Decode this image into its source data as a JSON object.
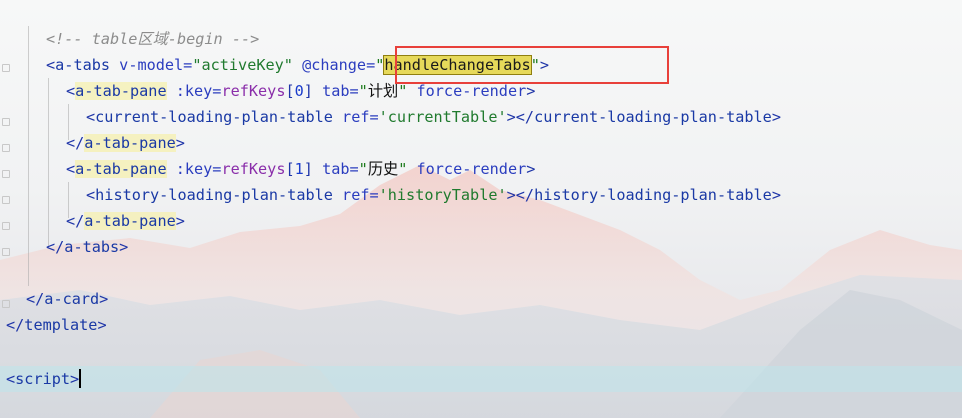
{
  "editor": {
    "lines": {
      "comment": "<!-- table区域-begin -->",
      "tabs_open": {
        "lt": "<",
        "name": "a-tabs",
        "attr1": " v-model=",
        "val1": "\"activeKey\"",
        "attr2": " @change=",
        "q1": "\"",
        "handler": "handleChangeTabs",
        "q2": "\"",
        "gt": ">"
      },
      "pane1_open": {
        "lt": "<",
        "name": "a-tab-pane",
        "attr1": " :key=",
        "expr": "refKeys",
        "idx_open": "[",
        "idx": "0",
        "idx_close": "]",
        "attr2": " tab=",
        "q1": "\"",
        "cjk": "计划",
        "q2": "\"",
        "attr3": " force-render",
        "gt": ">"
      },
      "current_table": {
        "lt": "<",
        "name": "current-loading-plan-table",
        "attr1": " ref=",
        "val1": "'currentTable'",
        "mid": "></",
        "close_name": "current-loading-plan-table",
        "gt": ">"
      },
      "pane1_close": {
        "lt": "</",
        "name": "a-tab-pane",
        "gt": ">"
      },
      "pane2_open": {
        "lt": "<",
        "name": "a-tab-pane",
        "attr1": " :key=",
        "expr": "refKeys",
        "idx_open": "[",
        "idx": "1",
        "idx_close": "]",
        "attr2": " tab=",
        "q1": "\"",
        "cjk": "历史",
        "q2": "\"",
        "attr3": " force-render",
        "gt": ">"
      },
      "history_table": {
        "lt": "<",
        "name": "history-loading-plan-table",
        "attr1": " ref=",
        "val1": "'historyTable'",
        "mid": "></",
        "close_name": "history-loading-plan-table",
        "gt": ">"
      },
      "pane2_close": {
        "lt": "</",
        "name": "a-tab-pane",
        "gt": ">"
      },
      "tabs_close": {
        "lt": "</",
        "name": "a-tabs",
        "gt": ">"
      },
      "card_close": {
        "lt": "</",
        "name": "a-card",
        "gt": ">"
      },
      "template_close": {
        "lt": "</",
        "name": "template",
        "gt": ">"
      },
      "script_open": {
        "lt": "<",
        "name": "script",
        "gt": ">"
      }
    }
  },
  "colors": {
    "highlight_box": "#e8403a",
    "search_match": "#e6d95a",
    "current_line": "#bee6eb"
  }
}
